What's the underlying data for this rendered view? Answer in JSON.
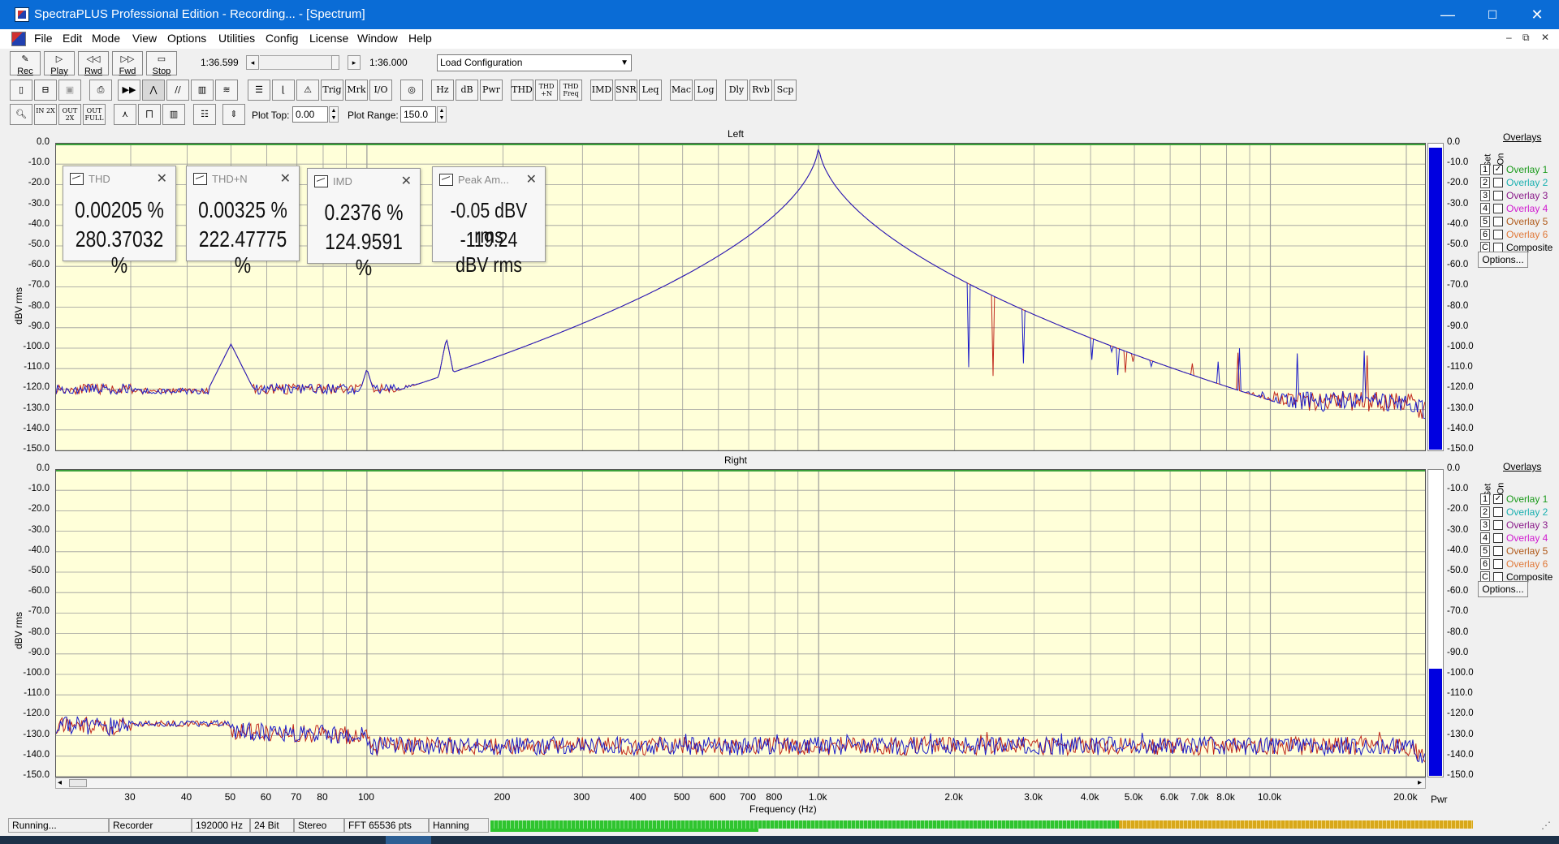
{
  "window": {
    "title": "SpectraPLUS Professional Edition - Recording... - [Spectrum]",
    "controls": [
      "—",
      "☐",
      "✕"
    ]
  },
  "menubar": {
    "items": [
      "File",
      "Edit",
      "Mode",
      "View",
      "Options",
      "Utilities",
      "Config",
      "License",
      "Window",
      "Help"
    ],
    "mdi_controls": [
      "–",
      "⧉",
      "✕"
    ]
  },
  "transport": {
    "buttons": [
      "Rec",
      "Play",
      "Rwd",
      "Fwd",
      "Stop"
    ],
    "position_left": "1:36.599",
    "position_right": "1:36.000",
    "config_select": "Load Configuration"
  },
  "toolbar2": {
    "analysis_buttons": [
      "Trig",
      "Mrk",
      "I/O",
      "Hz",
      "dB",
      "Pwr",
      "THD",
      "THD +N",
      "THD Freq",
      "IMD",
      "SNR",
      "Leq",
      "Mac",
      "Log",
      "Dly",
      "Rvb",
      "Scp"
    ]
  },
  "toolbar3": {
    "zoom_buttons": [
      "IN 2X",
      "OUT 2X",
      "OUT FULL"
    ],
    "plot_top_label": "Plot Top:",
    "plot_top_value": "0.00",
    "plot_range_label": "Plot Range:",
    "plot_range_value": "150.0"
  },
  "plots": {
    "left_title": "Left",
    "right_title": "Right",
    "ylabel": "dBV rms",
    "yticks": [
      "0.0",
      "-10.0",
      "-20.0",
      "-30.0",
      "-40.0",
      "-50.0",
      "-60.0",
      "-70.0",
      "-80.0",
      "-90.0",
      "-100.0",
      "-110.0",
      "-120.0",
      "-130.0",
      "-140.0",
      "-150.0"
    ],
    "xticks": [
      "30",
      "40",
      "50",
      "60",
      "70",
      "80",
      "100",
      "200",
      "300",
      "400",
      "500",
      "600",
      "700",
      "800",
      "1.0k",
      "2.0k",
      "3.0k",
      "4.0k",
      "5.0k",
      "6.0k",
      "7.0k",
      "8.0k",
      "10.0k",
      "20.0k"
    ],
    "xlabel": "Frequency (Hz)",
    "pwr_label": "Pwr",
    "scroll_left": "◂",
    "scroll_right": "▸"
  },
  "meters": {
    "left_level_fraction": 0.99,
    "right_level_fraction": 0.35,
    "color": "#0000e0"
  },
  "mini_windows": [
    {
      "title": "THD",
      "line1": "0.00205 %",
      "line2": "280.37032 %"
    },
    {
      "title": "THD+N",
      "line1": "0.00325 %",
      "line2": "222.47775 %"
    },
    {
      "title": "IMD",
      "line1": "0.2376 %",
      "line2": "124.9591 %"
    },
    {
      "title": "Peak Am...",
      "line1": "-0.05 dBV rms",
      "line2": "-119.24 dBV rms"
    }
  ],
  "overlays": {
    "header": "Overlays",
    "col_set": "Set",
    "col_on": "On",
    "rows": [
      {
        "num": "1",
        "label": "Overlay 1",
        "checked": "✓",
        "color": "#1a9a1a"
      },
      {
        "num": "2",
        "label": "Overlay 2",
        "checked": "",
        "color": "#1ab0b0"
      },
      {
        "num": "3",
        "label": "Overlay 3",
        "checked": "",
        "color": "#8a1a8a"
      },
      {
        "num": "4",
        "label": "Overlay 4",
        "checked": "",
        "color": "#d01ad0"
      },
      {
        "num": "5",
        "label": "Overlay 5",
        "checked": "",
        "color": "#b05a1a"
      },
      {
        "num": "6",
        "label": "Overlay 6",
        "checked": "",
        "color": "#e07a3a"
      },
      {
        "num": "C",
        "label": "Composite",
        "checked": "",
        "color": "#000000"
      }
    ],
    "options_label": "Options..."
  },
  "statusbar": {
    "cells": [
      "Running...",
      "Recorder",
      "192000 Hz",
      "24 Bit",
      "Stereo",
      "FFT 65536 pts",
      "Hanning"
    ]
  },
  "colors": {
    "plot_bg": "#ffffd9",
    "trace_blue": "#1c1cc8",
    "trace_red": "#c0281c",
    "grid": "#9a9a9a",
    "titlebar": "#0a6cd6"
  }
}
